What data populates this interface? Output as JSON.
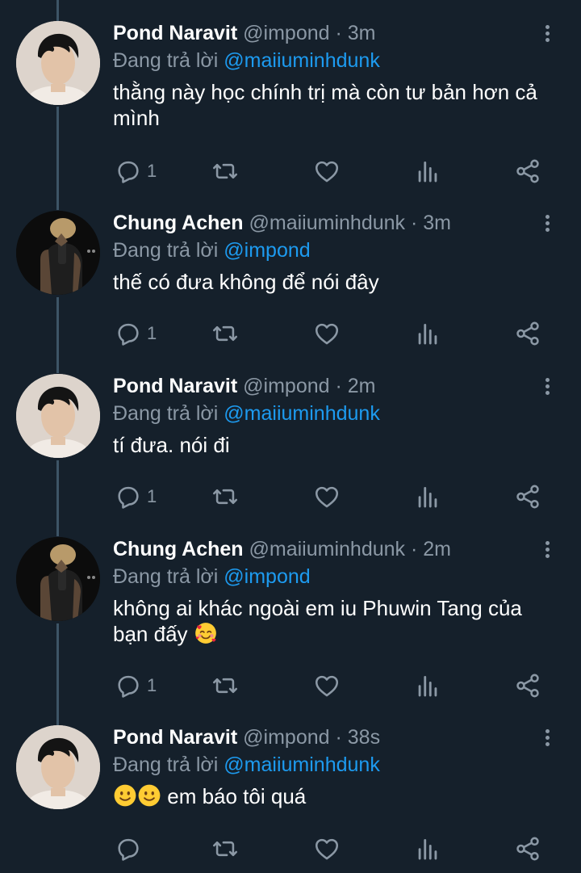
{
  "tweets": [
    {
      "name": "Pond Naravit",
      "handle": "@impond",
      "dot": "·",
      "time": "3m",
      "replying_prefix": "Đang trả lời",
      "replying_to": "@maiiuminhdunk",
      "text": "thằng này học chính trị mà còn tư bản hơn cả mình",
      "reply_count": "1"
    },
    {
      "name": "Chung Achen",
      "handle": "@maiiuminhdunk",
      "dot": "·",
      "time": "3m",
      "replying_prefix": "Đang trả lời",
      "replying_to": "@impond",
      "text": "thế có đưa không để nói đây",
      "reply_count": "1"
    },
    {
      "name": "Pond Naravit",
      "handle": "@impond",
      "dot": "·",
      "time": "2m",
      "replying_prefix": "Đang trả lời",
      "replying_to": "@maiiuminhdunk",
      "text": "tí đưa. nói đi",
      "reply_count": "1"
    },
    {
      "name": "Chung Achen",
      "handle": "@maiiuminhdunk",
      "dot": "·",
      "time": "2m",
      "replying_prefix": "Đang trả lời",
      "replying_to": "@impond",
      "text": "không ai khác ngoài em iu Phuwin Tang của bạn đấy",
      "reply_count": "1"
    },
    {
      "name": "Pond Naravit",
      "handle": "@impond",
      "dot": "·",
      "time": "38s",
      "replying_prefix": "Đang trả lời",
      "replying_to": "@maiiuminhdunk",
      "text": "em báo tôi quá",
      "reply_count": ""
    }
  ],
  "icons": {
    "reply": "reply-icon",
    "retweet": "retweet-icon",
    "like": "heart-icon",
    "views": "analytics-icon",
    "share": "share-icon",
    "more": "more-options-icon",
    "smile": "smiling-face-emoji",
    "hearts": "smiling-face-with-hearts-emoji"
  },
  "colors": {
    "background": "#15202b",
    "secondary_text": "#8b98a5",
    "mention": "#1d9bf0",
    "thread_line": "#3d5466"
  }
}
